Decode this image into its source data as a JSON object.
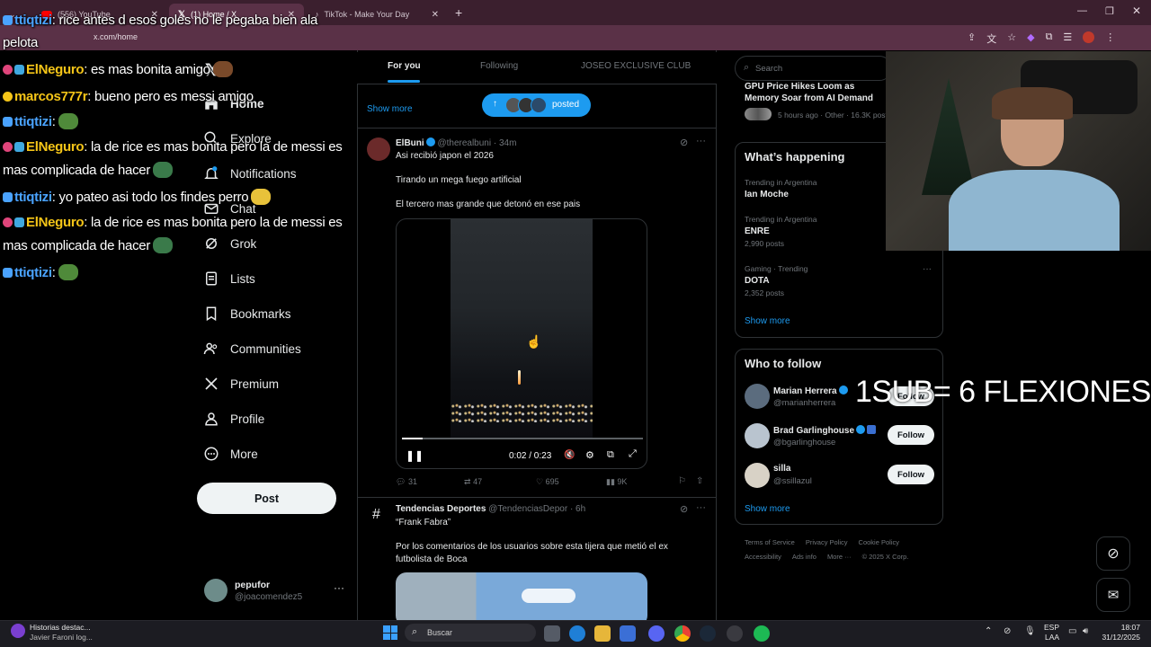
{
  "browser": {
    "tabs": [
      {
        "label": "(556) YouTube",
        "active": false
      },
      {
        "label": "(1) Home / X",
        "active": true
      },
      {
        "label": "TikTok - Make Your Day",
        "active": false
      }
    ],
    "url": "x.com/home"
  },
  "nav": {
    "items": [
      {
        "label": "Home",
        "icon": "home-icon"
      },
      {
        "label": "Explore",
        "icon": "search-icon"
      },
      {
        "label": "Notifications",
        "icon": "bell-icon"
      },
      {
        "label": "Chat",
        "icon": "mail-icon"
      },
      {
        "label": "Grok",
        "icon": "grok-icon"
      },
      {
        "label": "Lists",
        "icon": "list-icon"
      },
      {
        "label": "Bookmarks",
        "icon": "bookmark-icon"
      },
      {
        "label": "Communities",
        "icon": "people-icon"
      },
      {
        "label": "Premium",
        "icon": "x-logo-icon"
      },
      {
        "label": "Profile",
        "icon": "person-icon"
      },
      {
        "label": "More",
        "icon": "more-circle-icon"
      }
    ],
    "post_label": "Post",
    "account_name": "pepufor",
    "account_handle": "@joacomendez5"
  },
  "feed": {
    "tabs": [
      "For you",
      "Following",
      "JOSEO EXCLUSIVE CLUB"
    ],
    "show_more": "Show more",
    "posted_pill": "posted",
    "post1": {
      "name": "ElBuni",
      "handle": "@therealbuni",
      "time": "· 34m",
      "line1": "Asi recibió japon el 2026",
      "line2": "Tirando un mega fuego artificial",
      "line3": "El tercero mas grande que detonó en ese pais",
      "video_time": "0:02 / 0:23",
      "video_progress": 0.087,
      "replies": "31",
      "reposts": "47",
      "likes": "695",
      "views": "9K"
    },
    "post2": {
      "name": "Tendencias Deportes",
      "handle": "@TendenciasDepor",
      "time": "· 6h",
      "quote": "“Frank Fabra”",
      "body": "Por los comentarios de los usuarios sobre esta tijera que metió el ex futbolista de Boca"
    }
  },
  "sidebar": {
    "search_placeholder": "Search",
    "news_title": "GPU Price Hikes Loom as Memory Soar from AI Demand",
    "news_meta": "5 hours ago · Other · 16.3K posts",
    "happening_title": "What’s happening",
    "trends": [
      {
        "context": "Trending in Argentina",
        "name": "Ian Moche",
        "posts": ""
      },
      {
        "context": "Trending in Argentina",
        "name": "ENRE",
        "posts": "2,990 posts"
      },
      {
        "context": "Gaming · Trending",
        "name": "DOTA",
        "posts": "2,352 posts"
      }
    ],
    "show_more": "Show more",
    "who_title": "Who to follow",
    "follow_suggestions": [
      {
        "name": "Marian Herrera",
        "handle": "@marianherrera",
        "button": "Follow"
      },
      {
        "name": "Brad Garlinghouse",
        "handle": "@bgarlinghouse",
        "button": "Follow"
      },
      {
        "name": "silla",
        "handle": "@ssillazul",
        "button": "Follow"
      }
    ],
    "who_show_more": "Show more",
    "footer_line1": [
      "Terms of Service",
      "Privacy Policy",
      "Cookie Policy"
    ],
    "footer_line2": [
      "Accessibility",
      "Ads info",
      "More ···",
      "© 2025 X Corp."
    ]
  },
  "overlay": {
    "sub_text": "1SUB= 6 FLEXIONES",
    "chat": [
      {
        "user": "ttiqtizi",
        "msg": ": rice antes d esos goles no le pegaba bien ala"
      },
      {
        "user": "",
        "msg": "pelota"
      },
      {
        "user": "ElNeguro",
        "msg": ": es mas bonita amigo"
      },
      {
        "user": "marcos777r",
        "msg": ": bueno pero es messi amigo"
      },
      {
        "user": "ttiqtizi",
        "msg": ":"
      },
      {
        "user": "ElNeguro",
        "msg": ": la de rice es mas bonita pero la de messi es"
      },
      {
        "user": "",
        "msg": "mas complicada de hacer"
      },
      {
        "user": "ttiqtizi",
        "msg": ": yo pateo asi todo los findes perro"
      },
      {
        "user": "ElNeguro",
        "msg": ": la de rice es mas bonita pero la de messi es"
      },
      {
        "user": "",
        "msg": "mas complicada de hacer"
      },
      {
        "user": "ttiqtizi",
        "msg": ":"
      }
    ]
  },
  "taskbar": {
    "news_title": "Historias destac...",
    "news_sub": "Javier Faroni log...",
    "search_placeholder": "Buscar",
    "lang": "ESP",
    "lang_sub": "LAA",
    "time": "18:07",
    "date": "31/12/2025"
  },
  "colors": {
    "accent": "#1d9bf0",
    "browser_tab": "#3b1f2e",
    "browser_bar": "#5a3147",
    "chat_name_blue": "#4aa3ff",
    "chat_name_yellow": "#f5c518"
  }
}
